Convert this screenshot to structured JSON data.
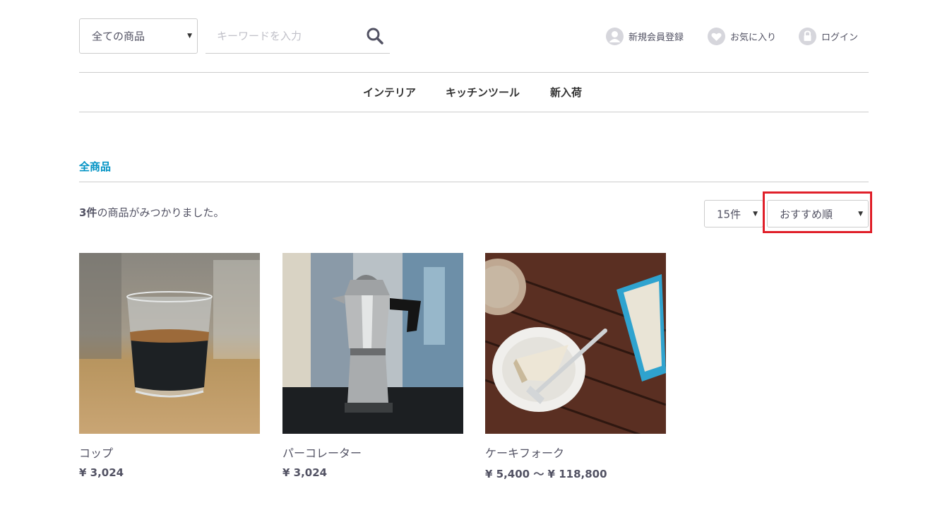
{
  "header": {
    "category_select": {
      "value": "全ての商品"
    },
    "search": {
      "placeholder": "キーワードを入力"
    },
    "links": {
      "register": "新規会員登録",
      "favorites": "お気に入り",
      "login": "ログイン"
    }
  },
  "nav": {
    "items": [
      "インテリア",
      "キッチンツール",
      "新入荷"
    ]
  },
  "breadcrumb": "全商品",
  "results": {
    "count": "3件",
    "text": "の商品がみつかりました。"
  },
  "sort": {
    "per_page": "15件",
    "order": "おすすめ順"
  },
  "products": [
    {
      "name": "コップ",
      "price": "¥ 3,024"
    },
    {
      "name": "パーコレーター",
      "price": "¥ 3,024"
    },
    {
      "name": "ケーキフォーク",
      "price": "¥ 5,400 ～ ¥ 118,800"
    }
  ],
  "colors": {
    "accent": "#0092c4",
    "highlight": "#e0202a",
    "text": "#525263"
  }
}
